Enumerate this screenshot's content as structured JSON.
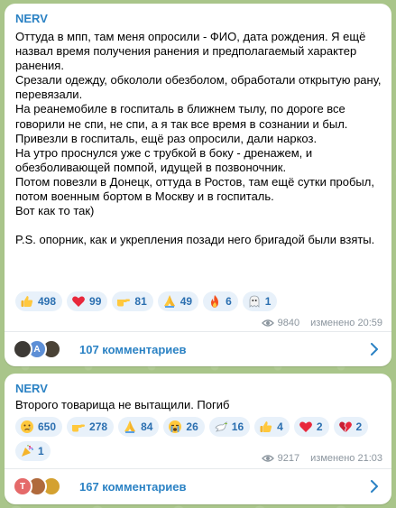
{
  "posts": [
    {
      "channel": "NERV",
      "paragraphs": [
        "Оттуда в мпп, там меня опросили - ФИО, дата рождения. Я ещё назвал время получения ранения и предполагаемый характер ранения.",
        "Срезали одежду, обкололи обезболом, обработали открытую рану, перевязали.",
        "На реанемобиле в госпиталь в ближнем тылу, по дороге все говорили не спи, не спи, а я так все время в сознании и был.",
        "Привезли в госпиталь, ещё раз опросили, дали наркоз.",
        "На утро проснулся уже с трубкой в боку - дренажем, и обезболивающей помпой, идущей в позвоночник.",
        "Потом повезли в Донецк, оттуда в Ростов, там ещё сутки пробыл, потом военным бортом в Москву и в госпиталь.",
        "Вот как то так)",
        "",
        "P.S. опорник, как и укрепления позади него бригадой были взяты."
      ],
      "reactions": [
        {
          "icon": "thumbs-up-icon",
          "count": "498"
        },
        {
          "icon": "red-heart-icon",
          "count": "99"
        },
        {
          "icon": "pointing-hand-icon",
          "count": "81"
        },
        {
          "icon": "praying-hands-icon",
          "count": "49"
        },
        {
          "icon": "fire-icon",
          "count": "6"
        },
        {
          "icon": "ghost-icon",
          "count": "1"
        }
      ],
      "views": "9840",
      "edited": "изменено 20:59",
      "comments_label": "107 комментариев",
      "avatars": [
        {
          "icon": "avatar-photo-1",
          "letter": "",
          "color": "#3d3a36"
        },
        {
          "icon": "avatar-letter",
          "letter": "A",
          "color": "#5d8fd6"
        },
        {
          "icon": "avatar-photo-2",
          "letter": "",
          "color": "#4a4236"
        }
      ]
    },
    {
      "channel": "NERV",
      "paragraphs": [
        "Второго товарища не вытащили. Погиб"
      ],
      "reactions": [
        {
          "icon": "crying-face-icon",
          "count": "650"
        },
        {
          "icon": "pointing-hand-icon",
          "count": "278"
        },
        {
          "icon": "praying-hands-icon",
          "count": "84"
        },
        {
          "icon": "sobbing-face-icon",
          "count": "26"
        },
        {
          "icon": "dove-icon",
          "count": "16"
        },
        {
          "icon": "thumbs-up-icon",
          "count": "4"
        },
        {
          "icon": "red-heart-icon",
          "count": "2"
        },
        {
          "icon": "broken-heart-icon",
          "count": "2"
        },
        {
          "icon": "party-popper-icon",
          "count": "1"
        }
      ],
      "views": "9217",
      "edited": "изменено 21:03",
      "comments_label": "167 комментариев",
      "avatars": [
        {
          "icon": "avatar-letter",
          "letter": "T",
          "color": "#e56a6a"
        },
        {
          "icon": "avatar-photo-3",
          "letter": "",
          "color": "#b06a3c"
        },
        {
          "icon": "avatar-photo-4",
          "letter": "",
          "color": "#d4a130"
        }
      ]
    }
  ],
  "colors": {
    "accent": "#2b82c4",
    "reaction_bg": "#e8f1fa",
    "meta": "#8b959e"
  }
}
